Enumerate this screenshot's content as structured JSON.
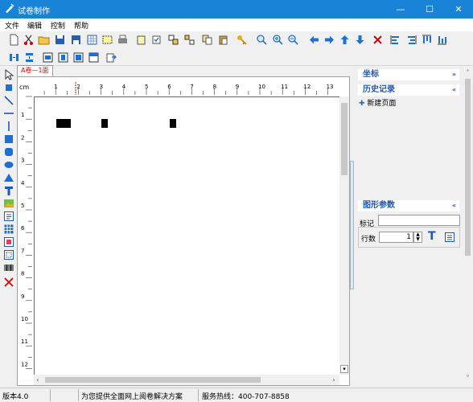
{
  "window": {
    "title": "试卷制作",
    "minimize": "—",
    "maximize": "☐",
    "close": "✕"
  },
  "menu": [
    "文件",
    "编辑",
    "控制",
    "帮助"
  ],
  "document_tab": "A卷—1面",
  "ruler": {
    "unit": "cm",
    "h_labels": [
      "1",
      "2",
      "3",
      "4",
      "5",
      "6",
      "7",
      "8",
      "9",
      "10",
      "11",
      "12",
      "13"
    ],
    "v_labels": [
      "1",
      "2",
      "3",
      "4",
      "5",
      "6",
      "7",
      "8",
      "9",
      "10",
      "11",
      "12"
    ]
  },
  "panel": {
    "coords": {
      "title": "坐标"
    },
    "history": {
      "title": "历史记录",
      "items": [
        "新建页面"
      ]
    },
    "shape_params": {
      "title": "图形参数",
      "mark_label": "标记",
      "mark_value": "",
      "rows_label": "行数",
      "rows_value": "1"
    }
  },
  "status": {
    "version": "版本4.0",
    "slogan": "为您提供全面网上阅卷解决方案",
    "hotline": "服务热线：400-707-8858"
  },
  "colors": {
    "titlebar": "#1883d7",
    "panel_header": "#1e58b8",
    "tab_text": "#e00000",
    "toolbar_icon_blue": "#1e6fd0"
  }
}
